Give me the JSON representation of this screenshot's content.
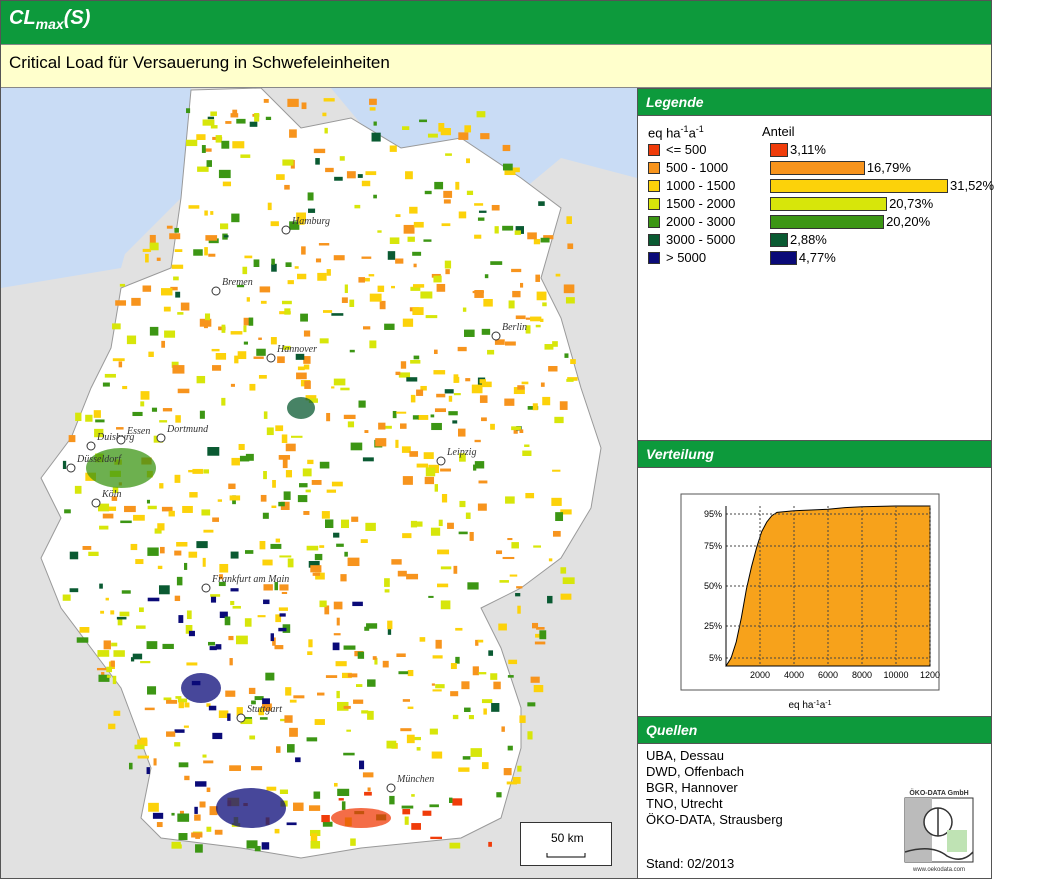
{
  "header": {
    "title_main": "CL",
    "title_sub": "max",
    "title_suffix": "(S)",
    "subtitle": "Critical Load für Versauerung in Schwefeleinheiten"
  },
  "legend": {
    "heading": "Legende",
    "unit_label": "eq ha",
    "unit_exp1": "-1",
    "unit_mid": "a",
    "unit_exp2": "-1",
    "share_label": "Anteil",
    "classes": [
      {
        "label": "<= 500",
        "share": "3,11%",
        "percent": 3.11,
        "color": "#f03c0a"
      },
      {
        "label": "500 - 1000",
        "share": "16,79%",
        "percent": 16.79,
        "color": "#f7941d"
      },
      {
        "label": "1000 - 1500",
        "share": "31,52%",
        "percent": 31.52,
        "color": "#fcd20a"
      },
      {
        "label": "1500 - 2000",
        "share": "20,73%",
        "percent": 20.73,
        "color": "#d7e60a"
      },
      {
        "label": "2000 - 3000",
        "share": "20,20%",
        "percent": 20.2,
        "color": "#3c9614"
      },
      {
        "label": "3000 - 5000",
        "share": "2,88%",
        "percent": 2.88,
        "color": "#0a5a32"
      },
      {
        "label": "> 5000",
        "share": "4,77%",
        "percent": 4.77,
        "color": "#0a0a78"
      }
    ]
  },
  "distribution": {
    "heading": "Verteilung",
    "chart_data": {
      "type": "area",
      "y_ticks": [
        "95%",
        "75%",
        "50%",
        "25%",
        "5%"
      ],
      "x_ticks": [
        "2000",
        "4000",
        "6000",
        "8000",
        "10000",
        "1200"
      ],
      "xlabel_main": "eq ha",
      "xlabel_exp1": "-1",
      "xlabel_mid": "a",
      "xlabel_exp2": "-1",
      "fill_color": "#f7a21b",
      "x": [
        0,
        300,
        600,
        900,
        1200,
        1500,
        1800,
        2100,
        2400,
        2700,
        3000,
        4000,
        6000,
        7000,
        8000,
        10000,
        12000
      ],
      "y": [
        0,
        5,
        15,
        30,
        48,
        62,
        74,
        84,
        90,
        94,
        96,
        97,
        98,
        99,
        99.5,
        100,
        100
      ],
      "xlim": [
        0,
        12000
      ],
      "ylim": [
        0,
        100
      ]
    }
  },
  "sources": {
    "heading": "Quellen",
    "items": [
      "UBA, Dessau",
      "DWD, Offenbach",
      "BGR, Hannover",
      "TNO, Utrecht",
      "ÖKO-DATA, Strausberg"
    ],
    "stand": "Stand: 02/2013",
    "logo_text": "ÖKO-DATA GmbH",
    "logo_url": "www.oekodata.com"
  },
  "map": {
    "scale_label": "50 km",
    "cities": [
      {
        "name": "Hamburg"
      },
      {
        "name": "Bremen"
      },
      {
        "name": "Berlin"
      },
      {
        "name": "Hannover"
      },
      {
        "name": "Dortmund"
      },
      {
        "name": "Duisburg"
      },
      {
        "name": "Essen"
      },
      {
        "name": "Düsseldorf"
      },
      {
        "name": "Köln"
      },
      {
        "name": "Leipzig"
      },
      {
        "name": "Frankfurt am Main"
      },
      {
        "name": "Stuttgart"
      },
      {
        "name": "München"
      }
    ]
  }
}
